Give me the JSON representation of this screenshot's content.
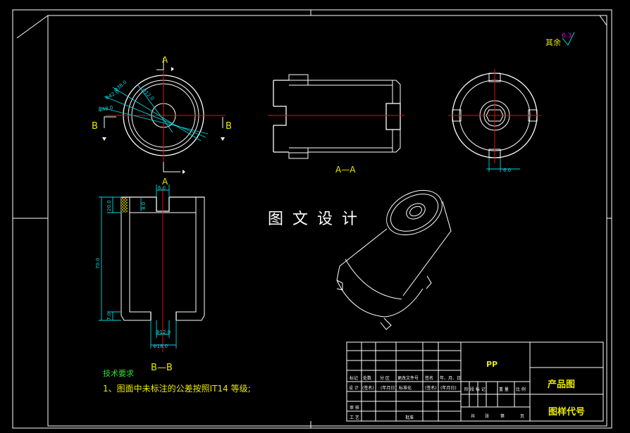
{
  "roughness": {
    "prefix": "其余",
    "value": "6.3"
  },
  "section_labels": {
    "a_top": "A",
    "a_bottom": "A",
    "b_left": "B",
    "b_right": "B",
    "aa": "A—A",
    "bb": "B—B"
  },
  "front_view_dims": [
    "Φ48.0",
    "Φ42.0",
    "Φ38.0",
    "Φ12.0"
  ],
  "right_view_dim": "6.0",
  "section_bb_dims": {
    "slot_width": "6.0",
    "slot_depth": "8.0",
    "upper_height": "20.0",
    "total_height": "70.0",
    "bottom_thickness": "7.0",
    "hole_inner": "Φ12.0",
    "hole_outer": "Φ18.0"
  },
  "watermark": "图 文 设 计",
  "tech_requirements": {
    "title": "技术要求",
    "item1": "1、图面中未标注的公差按照IT14 等级;"
  },
  "title_block": {
    "material": "PP",
    "drawing_name": "产品图",
    "drawing_code": "图样代号",
    "row_labels": [
      "标记",
      "处数",
      "分 区",
      "更改文件号",
      "签名",
      "年、月、日"
    ],
    "row_values": [
      "设 计",
      "(签名)",
      "(年月日)",
      "标准化",
      "(签名)",
      "(年月日)"
    ],
    "stage_labels": [
      "阶 段 标 记",
      "重 量",
      "比 例"
    ],
    "checks": [
      "审 核",
      "工 艺"
    ],
    "approve": "批准",
    "sheet_info": [
      "共",
      "张",
      "第",
      "页"
    ]
  }
}
